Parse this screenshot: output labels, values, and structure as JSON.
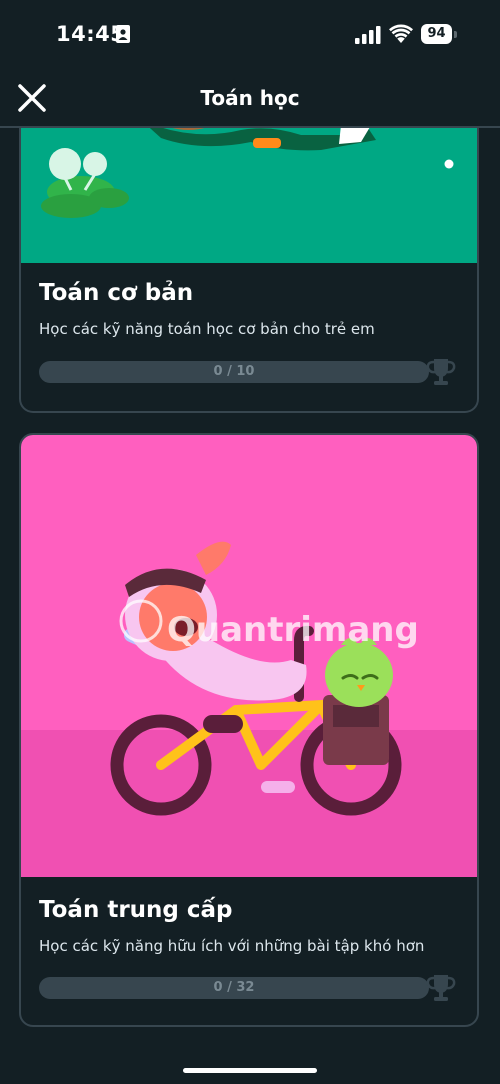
{
  "status_bar": {
    "time": "14:45",
    "battery": "94"
  },
  "header": {
    "title": "Toán học",
    "close_icon": "close-icon"
  },
  "courses": [
    {
      "title": "Toán cơ bản",
      "description": "Học các kỹ năng toán học cơ bản cho trẻ em",
      "progress_label": "0 / 10",
      "progress_fraction": 0,
      "image_bg": "#00a884"
    },
    {
      "title": "Toán trung cấp",
      "description": "Học các kỹ năng hữu ích với những bài tập khó hơn",
      "progress_label": "0 / 32",
      "progress_fraction": 0,
      "image_bg": "#ff5fbf"
    }
  ],
  "colors": {
    "background": "#131f24",
    "card_border": "#37464f",
    "progress_track": "#37464f",
    "progress_text": "#7a8a93"
  },
  "watermark": "Quantrimang"
}
